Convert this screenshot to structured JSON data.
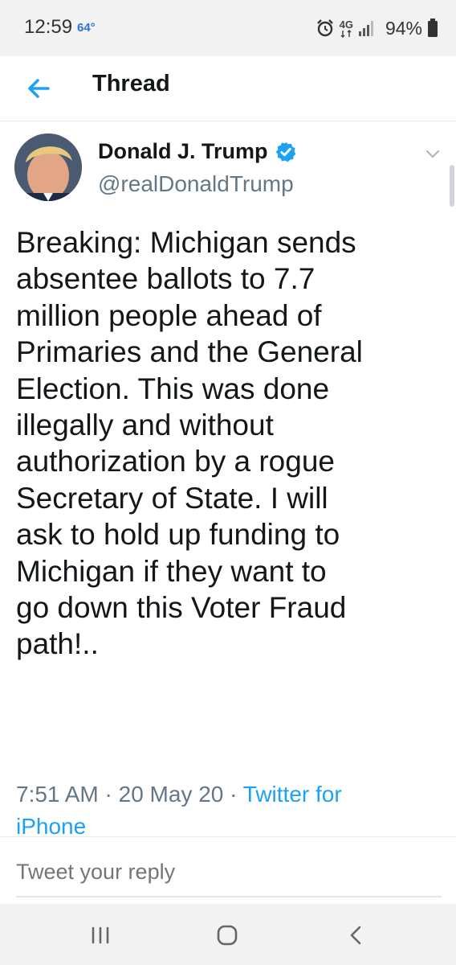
{
  "status_bar": {
    "time": "12:59",
    "temperature": "64°",
    "network": "4G",
    "battery": "94%",
    "icons": [
      "alarm-icon",
      "network-icon",
      "signal-icon",
      "battery-icon"
    ]
  },
  "header": {
    "title": "Thread",
    "back_icon": "back-arrow-icon"
  },
  "tweet": {
    "author_name": "Donald J. Trump",
    "handle": "@realDonaldTrump",
    "verified": true,
    "lines": [
      "Breaking: Michigan sends",
      "absentee ballots to 7.7",
      "million people ahead of",
      "Primaries and the General",
      "Election. This was done",
      "illegally and without",
      "authorization by a rogue",
      "Secretary of State. I will",
      "ask to hold up funding to",
      "Michigan if they want to",
      "go down this Voter Fraud",
      "path!.."
    ],
    "time": "7:51 AM",
    "date": "20 May 20",
    "source_line1": "Twitter for",
    "source_line2": "iPhone",
    "separator": "·"
  },
  "reply": {
    "placeholder": "Tweet your reply"
  },
  "colors": {
    "accent": "#1da1f2",
    "text": "#14171a",
    "secondary": "#657786",
    "temp": "#2a73d6"
  },
  "nav": {
    "icons": [
      "recent-apps-icon",
      "home-icon",
      "back-icon"
    ]
  }
}
